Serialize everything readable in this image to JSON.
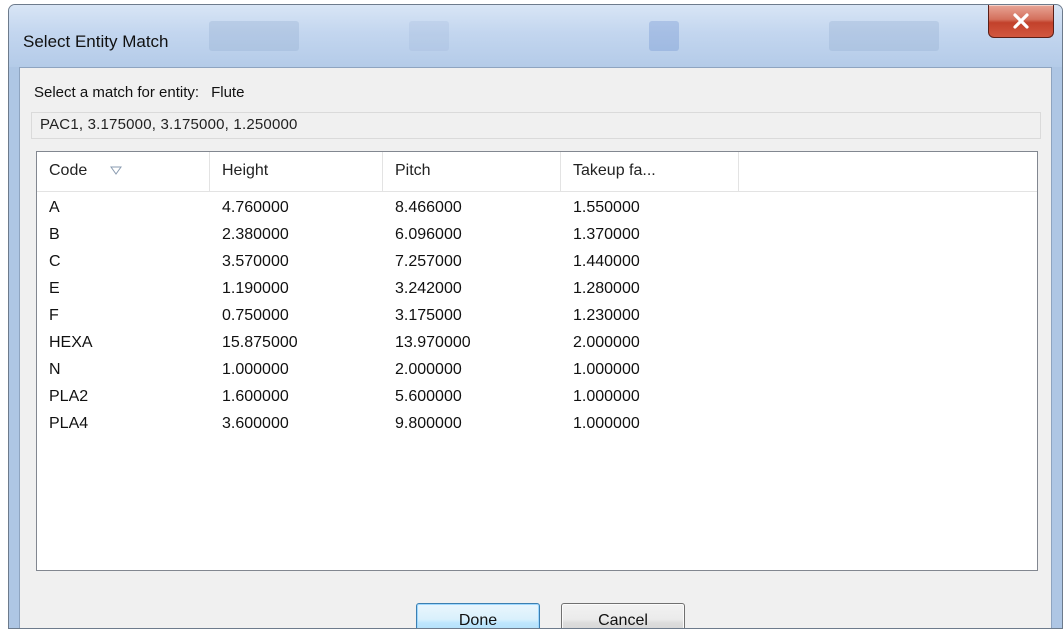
{
  "window": {
    "title": "Select Entity Match",
    "close_icon": "close-icon"
  },
  "prompt": {
    "label": "Select a match for entity:",
    "entity": "Flute"
  },
  "current_value": "PAC1, 3.175000, 3.175000, 1.250000",
  "table": {
    "columns": [
      "Code",
      "Height",
      "Pitch",
      "Takeup fa..."
    ],
    "sort_icon": "sort-descending-icon",
    "rows": [
      [
        "A",
        "4.760000",
        "8.466000",
        "1.550000"
      ],
      [
        "B",
        "2.380000",
        "6.096000",
        "1.370000"
      ],
      [
        "C",
        "3.570000",
        "7.257000",
        "1.440000"
      ],
      [
        "E",
        "1.190000",
        "3.242000",
        "1.280000"
      ],
      [
        "F",
        "0.750000",
        "3.175000",
        "1.230000"
      ],
      [
        "HEXA",
        "15.875000",
        "13.970000",
        "2.000000"
      ],
      [
        "N",
        "1.000000",
        "2.000000",
        "1.000000"
      ],
      [
        "PLA2",
        "1.600000",
        "5.600000",
        "1.000000"
      ],
      [
        "PLA4",
        "3.600000",
        "9.800000",
        "1.000000"
      ]
    ]
  },
  "buttons": {
    "done": "Done",
    "cancel": "Cancel"
  }
}
